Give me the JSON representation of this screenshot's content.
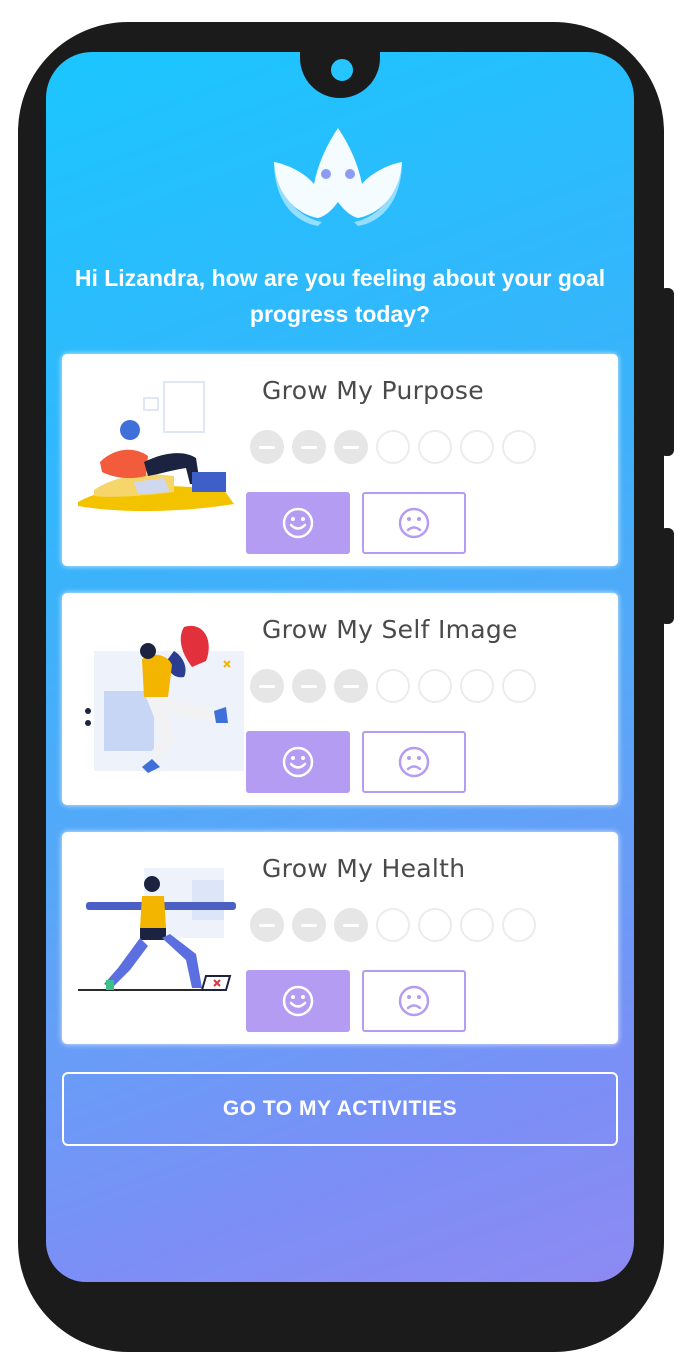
{
  "prompt": {
    "greeting": "Hi Lizandra, how are you feeling about your goal progress today?"
  },
  "goals": [
    {
      "title": "Grow My Purpose",
      "progress_filled": 3,
      "progress_total": 7,
      "illustration": "person-relaxing-with-laptop"
    },
    {
      "title": "Grow My Self Image",
      "progress_filled": 3,
      "progress_total": 7,
      "illustration": "person-jumping-with-lightbulb"
    },
    {
      "title": "Grow My Health",
      "progress_filled": 3,
      "progress_total": 7,
      "illustration": "person-doing-yoga"
    }
  ],
  "actions": {
    "happy_icon": "smiley-face-icon",
    "sad_icon": "sad-face-icon",
    "cta_label": "GO TO MY ACTIVITIES"
  },
  "colors": {
    "accent_purple": "#b49cf3",
    "gradient_top": "#1bc6ff",
    "gradient_bottom": "#8d8af2",
    "title_text": "#4a4a4a"
  }
}
